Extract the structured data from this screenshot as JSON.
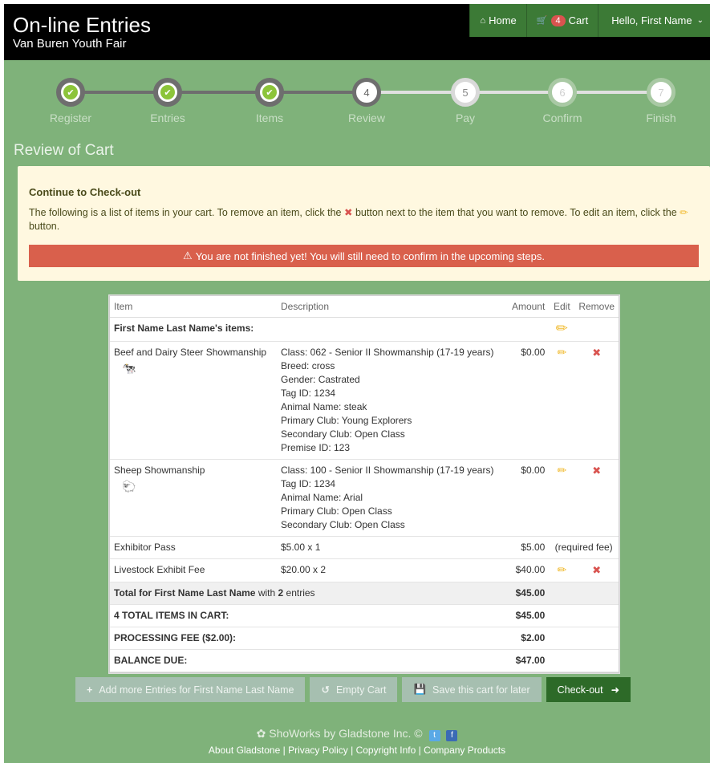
{
  "header": {
    "title": "On-line Entries",
    "subtitle": "Van Buren Youth Fair",
    "nav": {
      "home": "Home",
      "cart_count": "4",
      "cart": "Cart",
      "user": "Hello, First Name"
    }
  },
  "progress": {
    "steps": [
      {
        "num": "",
        "label": "Register",
        "state": "done"
      },
      {
        "num": "",
        "label": "Entries",
        "state": "done"
      },
      {
        "num": "",
        "label": "Items",
        "state": "done"
      },
      {
        "num": "4",
        "label": "Review",
        "state": "current"
      },
      {
        "num": "5",
        "label": "Pay",
        "state": "next"
      },
      {
        "num": "6",
        "label": "Confirm",
        "state": "future"
      },
      {
        "num": "7",
        "label": "Finish",
        "state": "future"
      }
    ]
  },
  "review_title": "Review of Cart",
  "alert": {
    "heading": "Continue to Check-out",
    "text_1": "The following is a list of items in your cart. To remove an item, click the",
    "text_2": "button next to the item that you want to remove. To edit an item, click the",
    "text_3": "button.",
    "warning": "You are not finished yet! You will still need to confirm in the upcoming steps."
  },
  "table": {
    "headers": {
      "item": "Item",
      "description": "Description",
      "amount": "Amount",
      "edit": "Edit",
      "remove": "Remove"
    },
    "owner_row": "First Name Last Name's items:",
    "items": [
      {
        "name": "Beef and Dairy Steer Showmanship",
        "icon": "cow-icon",
        "desc": [
          "Class: 062 - Senior II Showmanship (17-19 years)",
          "Breed: cross",
          "Gender: Castrated",
          "Tag ID: 1234",
          "Animal Name: steak",
          "Primary Club: Young Explorers",
          "Secondary Club: Open Class",
          "Premise ID: 123"
        ],
        "amount": "$0.00"
      },
      {
        "name": "Sheep Showmanship",
        "icon": "sheep-icon",
        "desc": [
          "Class: 100 - Senior II Showmanship (17-19 years)",
          "Tag ID: 1234",
          "Animal Name: Arial",
          "Primary Club: Open Class",
          "Secondary Club: Open Class"
        ],
        "amount": "$0.00"
      }
    ],
    "exhibitor_pass": {
      "name": "Exhibitor Pass",
      "desc": "$5.00 x 1",
      "amount": "$5.00",
      "note": "(required fee)"
    },
    "livestock_fee": {
      "name": "Livestock Exhibit Fee",
      "desc": "$20.00 x 2",
      "amount": "$40.00"
    },
    "total_row": {
      "prefix": "Total for First Name Last Name",
      "mid": " with ",
      "count": "2",
      "suffix": " entries",
      "amount": "$45.00"
    },
    "total_items": {
      "label": "4 TOTAL ITEMS IN CART:",
      "amount": "$45.00"
    },
    "processing": {
      "label": "PROCESSING FEE ($2.00):",
      "amount": "$2.00"
    },
    "balance": {
      "label": "BALANCE DUE:",
      "amount": "$47.00"
    }
  },
  "buttons": {
    "add_more": "Add more Entries for First Name Last Name",
    "empty": "Empty Cart",
    "save": "Save this cart for later",
    "checkout": "Check-out"
  },
  "footer": {
    "brand": "ShoWorks by Gladstone Inc. ©",
    "links": [
      "About Gladstone",
      "Privacy Policy",
      "Copyright Info",
      "Company Products"
    ]
  }
}
